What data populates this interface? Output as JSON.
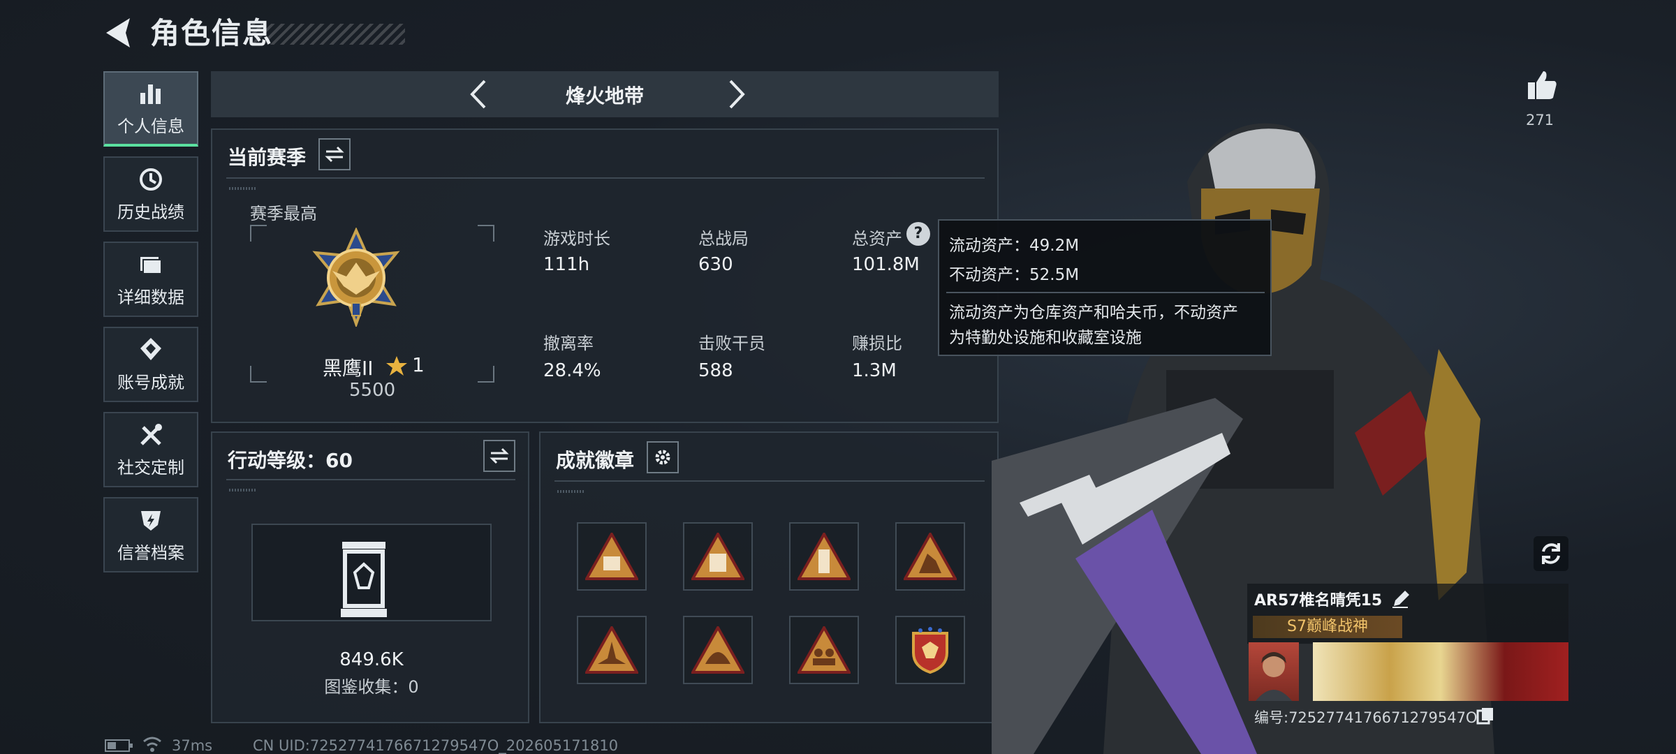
{
  "header": {
    "title": "角色信息"
  },
  "sidebar": {
    "items": [
      {
        "label": "个人信息",
        "icon": "bar-chart-icon",
        "active": true
      },
      {
        "label": "历史战绩",
        "icon": "history-icon",
        "active": false
      },
      {
        "label": "详细数据",
        "icon": "folder-icon",
        "active": false
      },
      {
        "label": "账号成就",
        "icon": "achievement-icon",
        "active": false
      },
      {
        "label": "社交定制",
        "icon": "tools-icon",
        "active": false
      },
      {
        "label": "信誉档案",
        "icon": "reputation-icon",
        "active": false
      }
    ]
  },
  "mode": {
    "title": "烽火地带"
  },
  "season": {
    "title": "当前赛季",
    "best_label": "赛季最高",
    "rank_name": "黑鹰II",
    "rank_stars": "1",
    "rank_score": "5500",
    "stats": [
      {
        "label": "游戏时长",
        "value": "111h"
      },
      {
        "label": "总战局",
        "value": "630"
      },
      {
        "label": "总资产",
        "value": "101.8M"
      },
      {
        "label": "撤离率",
        "value": "28.4%"
      },
      {
        "label": "击败干员",
        "value": "588"
      },
      {
        "label": "赚损比",
        "value": "1.3M"
      }
    ]
  },
  "tooltip": {
    "liquid": "流动资产：49.2M",
    "fixed": "不动资产：52.5M",
    "note_line1": "流动资产为仓库资产和哈夫币，不动资产",
    "note_line2": "为特勤处设施和收藏室设施"
  },
  "action": {
    "title": "行动等级：60",
    "value": "849.6K",
    "collection": "图鉴收集：0"
  },
  "badges": {
    "title": "成就徽章",
    "items": [
      "badge-s6-icon",
      "badge-s8-icon",
      "badge-tower-icon",
      "badge-runner-icon",
      "badge-plane-icon",
      "badge-helmet-icon",
      "badge-squad-icon",
      "badge-shield-eagle-icon"
    ]
  },
  "player": {
    "likes": "271",
    "name": "AR57椎名晴凭15",
    "title_badge": "S7巅峰战神",
    "id": "编号:7252774176671279547O"
  },
  "footer": {
    "latency": "37ms",
    "uid": "CN UID:7252774176671279547O_202605171810"
  },
  "colors": {
    "accent": "#5be0a0",
    "gold": "#d9a441",
    "panel": "#1f262d"
  }
}
